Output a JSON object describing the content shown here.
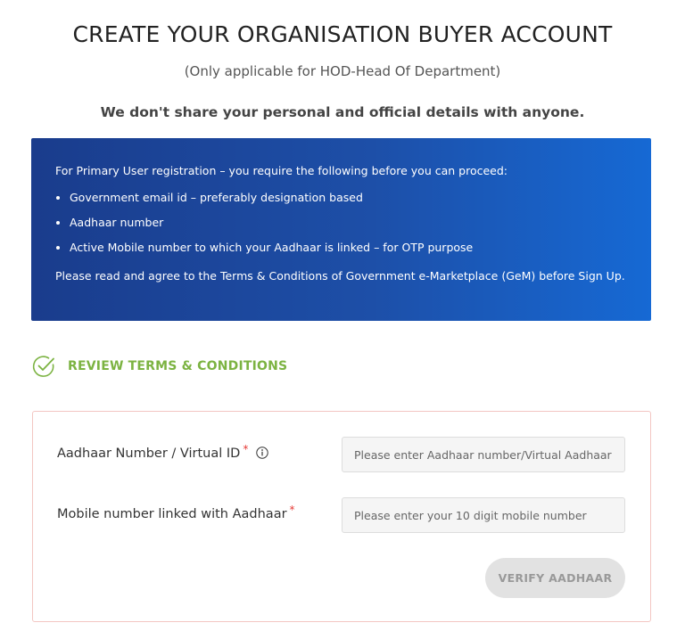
{
  "header": {
    "title": "CREATE YOUR ORGANISATION BUYER ACCOUNT",
    "subtitle": "(Only applicable for HOD-Head Of Department)",
    "privacy_note": "We don't share your personal and official details with anyone."
  },
  "info_box": {
    "intro": "For Primary User registration – you require the following before you can proceed:",
    "requirements": [
      "Government email id – preferably designation based",
      "Aadhaar number",
      "Active Mobile number to which your Aadhaar is linked – for OTP purpose"
    ],
    "terms_note": "Please read and agree to the Terms & Conditions of Government e-Marketplace (GeM) before Sign Up.",
    "gradient_colors": [
      "#1a3c8c",
      "#1669d4"
    ]
  },
  "review": {
    "label": "REVIEW TERMS & CONDITIONS",
    "icon": "check-circle-icon",
    "color": "#7cb342"
  },
  "form": {
    "aadhaar": {
      "label": "Aadhaar Number / Virtual ID",
      "required_mark": "*",
      "info_icon": "info-icon",
      "value": "",
      "placeholder": "Please enter Aadhaar number/Virtual Aadhaar"
    },
    "mobile": {
      "label": "Mobile number linked with Aadhaar",
      "required_mark": "*",
      "value": "",
      "placeholder": "Please enter your 10 digit mobile number"
    },
    "verify_button": {
      "label": "VERIFY AADHAAR",
      "state": "disabled"
    },
    "border_color": "#f3c6c2",
    "required_color": "#e53935"
  }
}
